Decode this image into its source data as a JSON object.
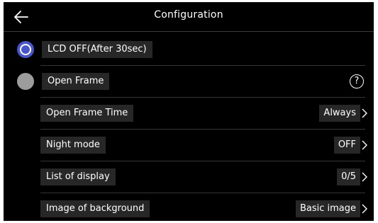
{
  "header": {
    "title": "Configuration",
    "back_icon": "back-arrow-icon"
  },
  "options": {
    "lcd_off": {
      "label": "LCD OFF(After 30sec)",
      "selected": true
    },
    "open_frame": {
      "label": "Open Frame",
      "selected": false,
      "help_glyph": "?"
    }
  },
  "settings": {
    "open_frame_time": {
      "label": "Open Frame Time",
      "value": "Always"
    },
    "night_mode": {
      "label": "Night mode",
      "value": "OFF"
    },
    "list_of_display": {
      "label": "List of display",
      "value": "0/5"
    },
    "image_of_background": {
      "label": "Image of background",
      "value": "Basic image"
    }
  },
  "colors": {
    "background": "#000000",
    "radio_selected": "#4856c9",
    "radio_unselected": "#9c9c9c",
    "chip_background": "#272727",
    "text": "#ffffff"
  }
}
